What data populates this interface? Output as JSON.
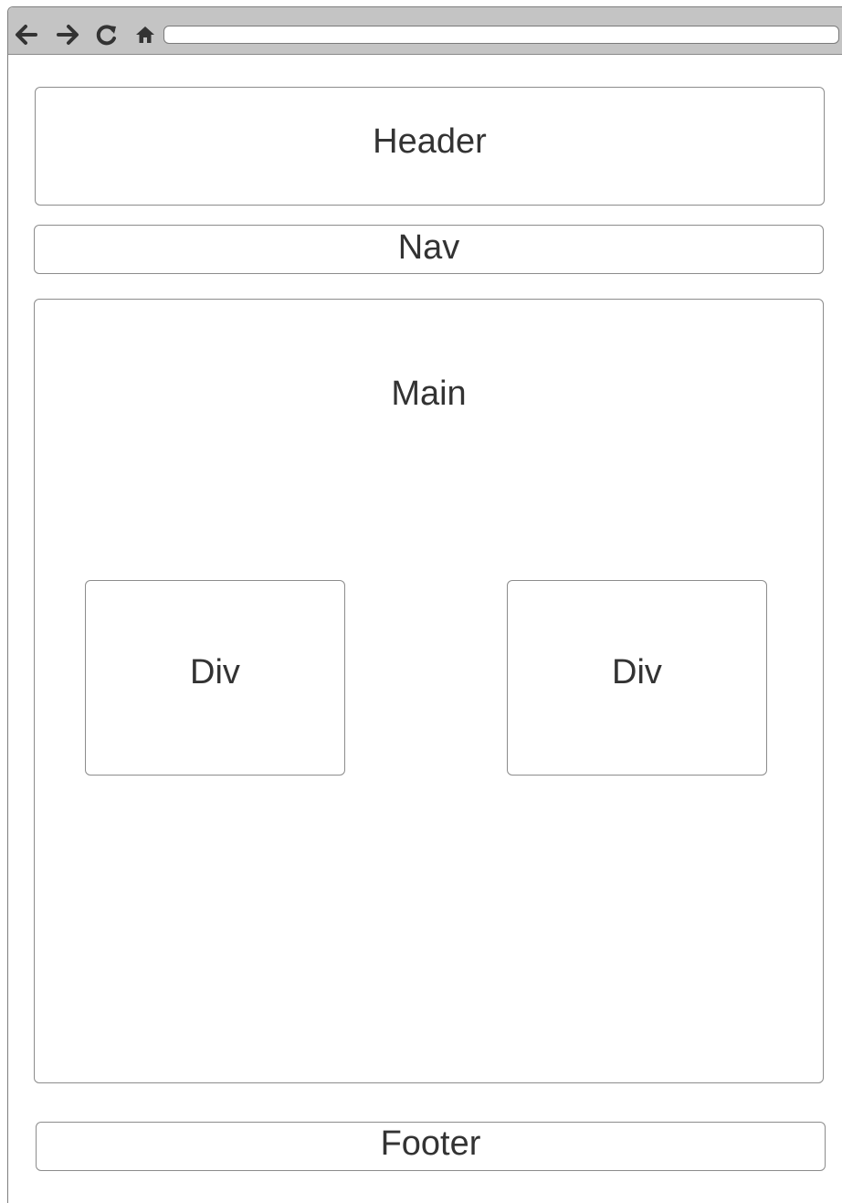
{
  "browser": {
    "address_value": "",
    "icons": [
      "back-arrow-icon",
      "forward-arrow-icon",
      "reload-icon",
      "home-icon"
    ]
  },
  "layout_labels": {
    "header": "Header",
    "nav": "Nav",
    "main": "Main",
    "div_left": "Div",
    "div_right": "Div",
    "footer": "Footer"
  },
  "colors": {
    "toolbar": "#c4c4c4",
    "border": "#8c8c8c",
    "text": "#333333",
    "icon": "#333333"
  }
}
